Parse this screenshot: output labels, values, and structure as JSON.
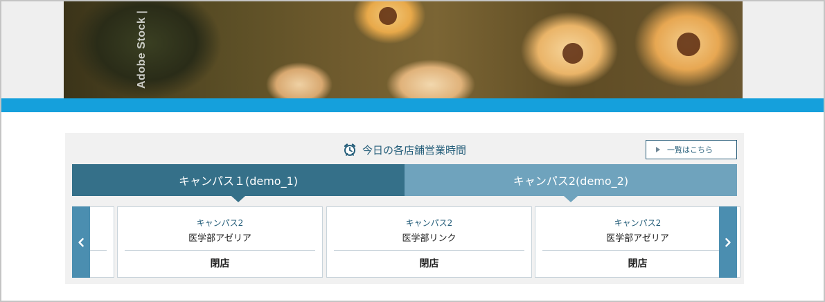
{
  "hero": {
    "watermark": "Adobe Stock |"
  },
  "panel": {
    "title": "今日の各店舗営業時間",
    "title_icon": "alarm-clock-icon",
    "list_button_label": "一覧はこちら"
  },
  "tabs": [
    {
      "label": "キャンパス１(demo_1)",
      "active": true
    },
    {
      "label": "キャンパス2(demo_2)",
      "active": false
    }
  ],
  "stores": [
    {
      "campus": "キャンパス2",
      "name": "医学部アゼリア",
      "status": "閉店"
    },
    {
      "campus": "キャンパス2",
      "name": "医学部リンク",
      "status": "閉店"
    },
    {
      "campus": "キャンパス2",
      "name": "医学部アゼリア",
      "status": "閉店"
    }
  ],
  "colors": {
    "accent_blue": "#15a0dc",
    "tab_active": "#357089",
    "tab_inactive": "#6fa3bd",
    "nav_arrow": "#4b8eb0",
    "text_link": "#255e7a"
  },
  "icons": {
    "prev": "chevron-left-icon",
    "next": "chevron-right-icon"
  }
}
